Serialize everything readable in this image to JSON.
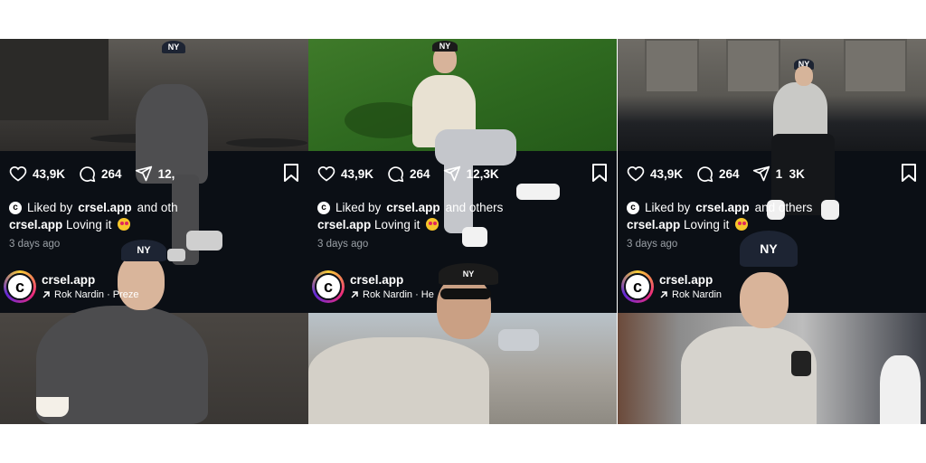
{
  "posts": [
    {
      "likes": "43,9K",
      "comments": "264",
      "shares": "12,",
      "liked_by_prefix": "Liked by",
      "liked_by_user": "crsel.app",
      "liked_by_suffix": "and oth",
      "caption_user": "crsel.app",
      "caption_text": "Loving it",
      "time_ago": "3 days ago",
      "account_name": "crsel.app",
      "account_sub": "Rok Nardin · Preze",
      "avatar_letter": "c"
    },
    {
      "likes": "43,9K",
      "comments": "264",
      "shares": "12,3K",
      "liked_by_prefix": "Liked by",
      "liked_by_user": "crsel.app",
      "liked_by_suffix": "and others",
      "caption_user": "crsel.app",
      "caption_text": "Loving it",
      "time_ago": "3 days ago",
      "account_name": "crsel.app",
      "account_sub": "Rok Nardin · He",
      "avatar_letter": "c"
    },
    {
      "likes": "43,9K",
      "comments": "264",
      "shares": "1  3K",
      "liked_by_prefix": "Liked by",
      "liked_by_user": "crsel.app",
      "liked_by_suffix": "and others",
      "caption_user": "crsel.app",
      "caption_text": "Loving it",
      "time_ago": "3 days ago",
      "account_name": "crsel.app",
      "account_sub": "Rok Nardin",
      "avatar_letter": "c"
    }
  ],
  "cap_logo": "NY",
  "icons": {
    "like": "heart-icon",
    "comment": "comment-icon",
    "share": "send-icon",
    "save": "bookmark-icon",
    "tag": "arrow-up-right-icon"
  },
  "colors": {
    "panel_bg": "#0b0f15",
    "muted_text": "#9aa0a6"
  }
}
